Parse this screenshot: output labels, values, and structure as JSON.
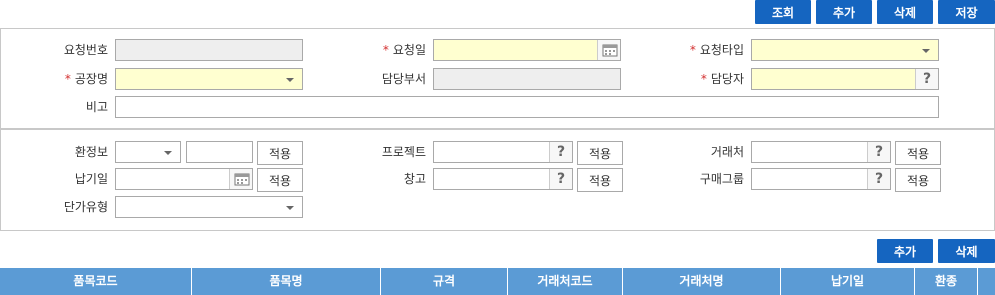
{
  "toolbar": {
    "search": "조회",
    "add": "추가",
    "delete": "삭제",
    "save": "저장"
  },
  "form": {
    "req_no": "요청번호",
    "req_date": "요청일",
    "req_type": "요청타입",
    "factory": "공장명",
    "dept": "담당부서",
    "manager": "담당자",
    "remark": "비고",
    "req_mark": "*"
  },
  "filters": {
    "currency": "환정보",
    "project": "프로젝트",
    "vendor": "거래처",
    "due_date": "납기일",
    "warehouse": "창고",
    "purchase_group": "구매그룹",
    "price_type": "단가유형",
    "apply": "적용",
    "help": "?"
  },
  "grid_toolbar": {
    "add": "추가",
    "delete": "삭제"
  },
  "table": {
    "columns": [
      "품목코드",
      "품목명",
      "규격",
      "거래처코드",
      "거래처명",
      "납기일",
      "환종"
    ]
  },
  "colors": {
    "accent": "#1565c0",
    "header": "#5b9bd5",
    "required": "#d32f2f",
    "highlight": "#ffffd0"
  }
}
